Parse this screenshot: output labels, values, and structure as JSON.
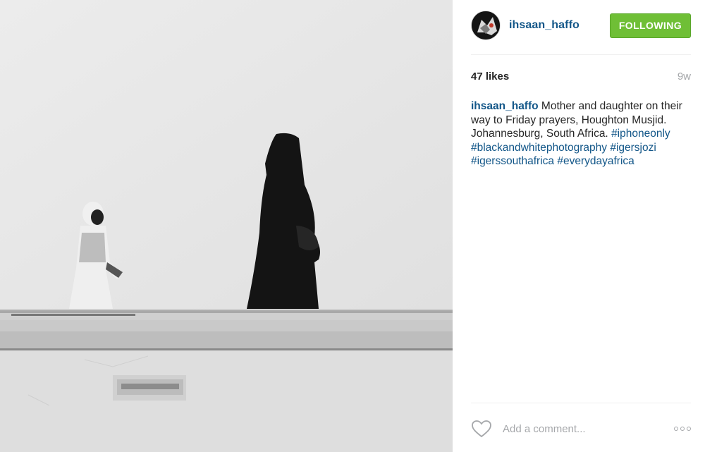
{
  "post": {
    "photo_alt": "Black and white photo",
    "username": "ihsaan_haffo",
    "follow_label": "FOLLOWING",
    "likes": "47 likes",
    "age": "9w",
    "caption": {
      "username": "ihsaan_haffo",
      "text": " Mother and daughter on their way to Friday prayers, Houghton Musjid. Johannesburg, South Africa. ",
      "hashtags": [
        "#iphoneonly",
        "#blackandwhitephotography",
        "#igersjozi",
        "#igerssouthafrica",
        "#everydayafrica"
      ]
    },
    "comment": {
      "placeholder": "Add a comment..."
    }
  },
  "icons": {
    "heart": "heart-icon",
    "more": "more-options-icon",
    "avatar": "avatar"
  },
  "colors": {
    "accent_link": "#125688",
    "follow_bg": "#6fbf36",
    "muted": "#a5a7aa"
  }
}
